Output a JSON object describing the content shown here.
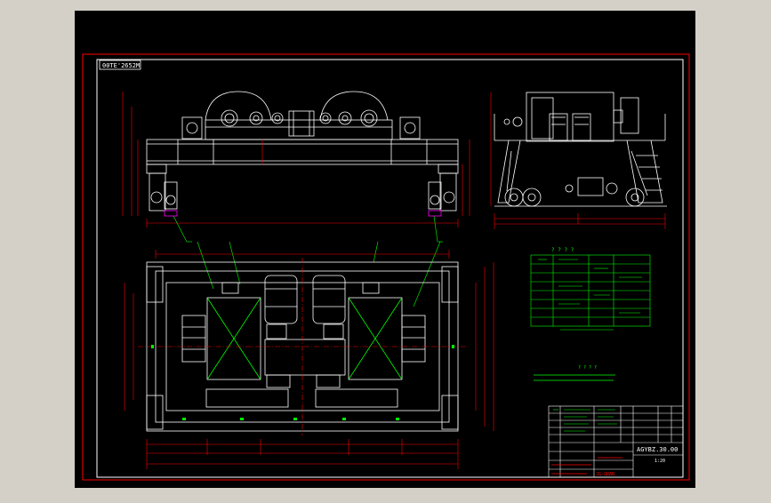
{
  "drawing": {
    "stamp_top_left": "00TE'2652M",
    "drawing_number": "AGYBZ.30.00",
    "title_block_code": "JG-QUAN",
    "scale_text": "1:20",
    "tech_notes_title": "? ? ? ?",
    "parts_table_title": "? ? ? ?"
  },
  "colors": {
    "background": "#000000",
    "frame": "#ff0000",
    "lines": "#ffffff",
    "dimensions": "#ff0000",
    "table": "#00ff00",
    "leaders": "#00ff00"
  }
}
